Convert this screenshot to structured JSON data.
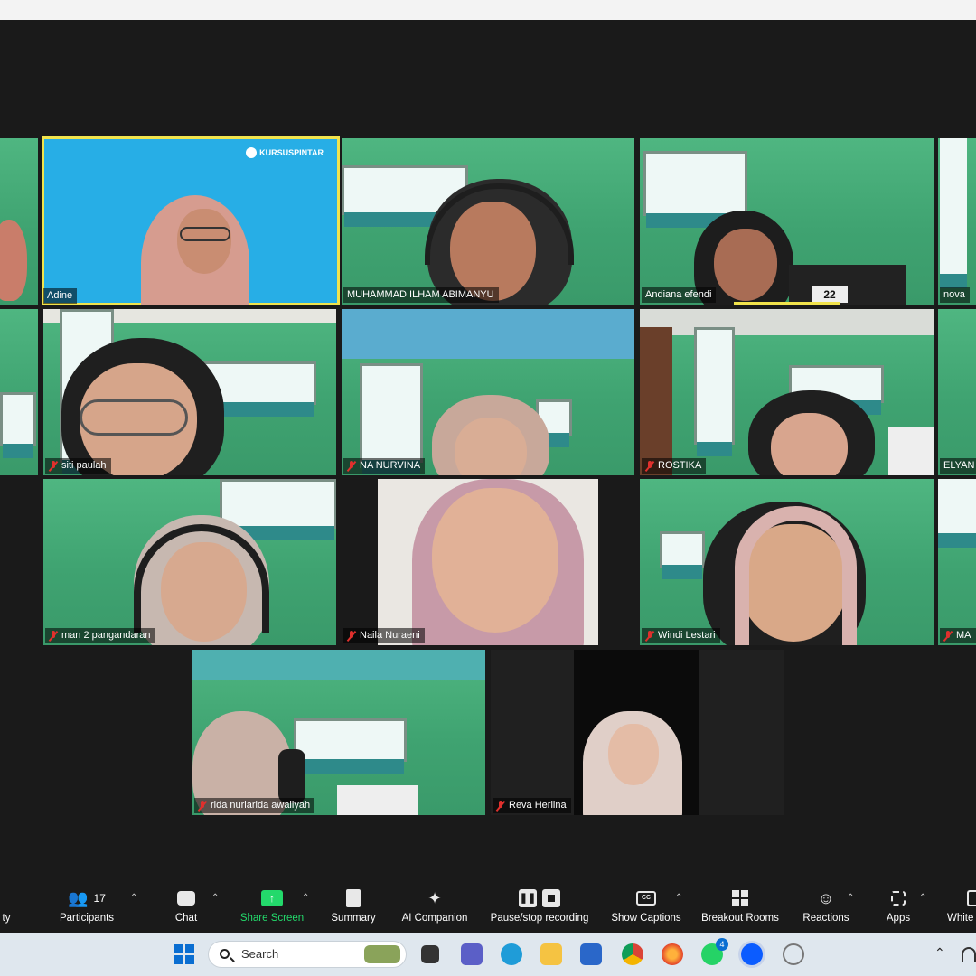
{
  "participants": [
    {
      "name": ""
    },
    {
      "name": "Adine"
    },
    {
      "name": "MUHAMMAD ILHAM ABIMANYU"
    },
    {
      "name": "Andiana efendi"
    },
    {
      "name": "nova"
    },
    {
      "name": ""
    },
    {
      "name": "siti paulah"
    },
    {
      "name": "NA NURVINA"
    },
    {
      "name": "ROSTIKA"
    },
    {
      "name": "ELYAN"
    },
    {
      "name": "man 2 pangandaran"
    },
    {
      "name": "Naila Nuraeni"
    },
    {
      "name": "Windi Lestari"
    },
    {
      "name": "MA"
    },
    {
      "name": "rida nurlarida awaliyah"
    },
    {
      "name": "Reva Herlina"
    }
  ],
  "slide_logo": "KURSUSPINTAR",
  "tile_number": "22",
  "toolbar": {
    "security_label_partial": "ty",
    "participants_label": "Participants",
    "participants_count": "17",
    "chat_label": "Chat",
    "share_label": "Share Screen",
    "summary_label": "Summary",
    "ai_label": "AI Companion",
    "record_label": "Pause/stop recording",
    "captions_label": "Show Captions",
    "breakout_label": "Breakout Rooms",
    "reactions_label": "Reactions",
    "apps_label": "Apps",
    "whiteboard_label_partial": "White",
    "share_color": "#23d96b"
  },
  "taskbar": {
    "search_placeholder": "Search",
    "whatsapp_badge": "4"
  }
}
